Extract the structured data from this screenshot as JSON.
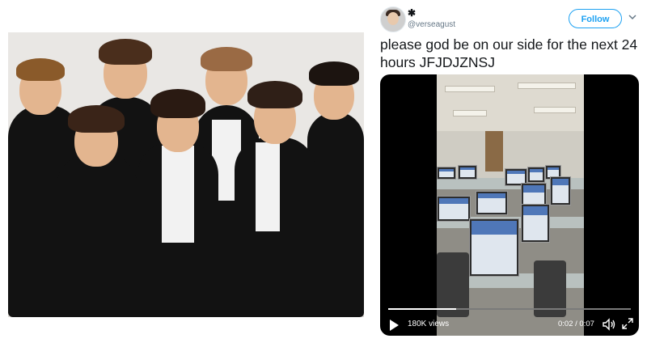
{
  "photo": {
    "description_icon": "group-photo-image"
  },
  "tweet": {
    "display_name": "✱",
    "handle": "@verseagust",
    "follow_label": "Follow",
    "more_icon": "chevron-down-icon",
    "text": "please god be on our side for the next 24 hours JFJDJZNSJ"
  },
  "video": {
    "views": "180K views",
    "time": "0:02 / 0:07",
    "progress": 0.28,
    "icons": [
      "play-icon",
      "volume-icon",
      "fullscreen-icon"
    ]
  },
  "colors": {
    "accent": "#1da1f2",
    "text": "#14171a",
    "muted": "#657786"
  }
}
